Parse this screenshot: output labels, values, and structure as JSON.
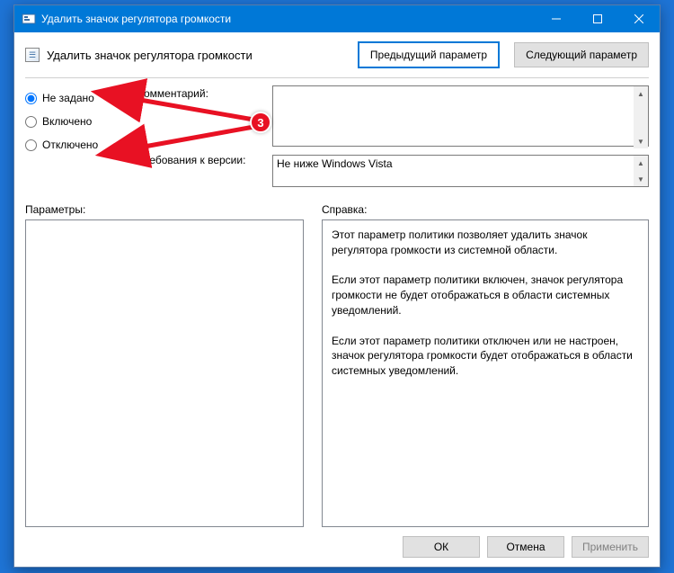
{
  "window": {
    "title": "Удалить значок регулятора громкости"
  },
  "header": {
    "heading": "Удалить значок регулятора громкости",
    "prev": "Предыдущий параметр",
    "next": "Следующий параметр"
  },
  "options": {
    "not_configured": "Не задано",
    "enabled": "Включено",
    "disabled": "Отключено",
    "selected": "not_configured",
    "comment_label": "Комментарий:",
    "comment_value": "",
    "requirements_label": "Требования к версии:",
    "requirements_value": "Не ниже Windows Vista"
  },
  "sections": {
    "params_label": "Параметры:",
    "help_label": "Справка:",
    "help_body": "Этот параметр политики позволяет удалить значок регулятора громкости из системной области.\n\nЕсли этот параметр политики включен, значок регулятора громкости не будет отображаться в области системных уведомлений.\n\nЕсли этот параметр политики отключен или не настроен, значок регулятора громкости будет отображаться в области системных уведомлений."
  },
  "footer": {
    "ok": "ОК",
    "cancel": "Отмена",
    "apply": "Применить"
  },
  "annotation": {
    "number": "3"
  }
}
